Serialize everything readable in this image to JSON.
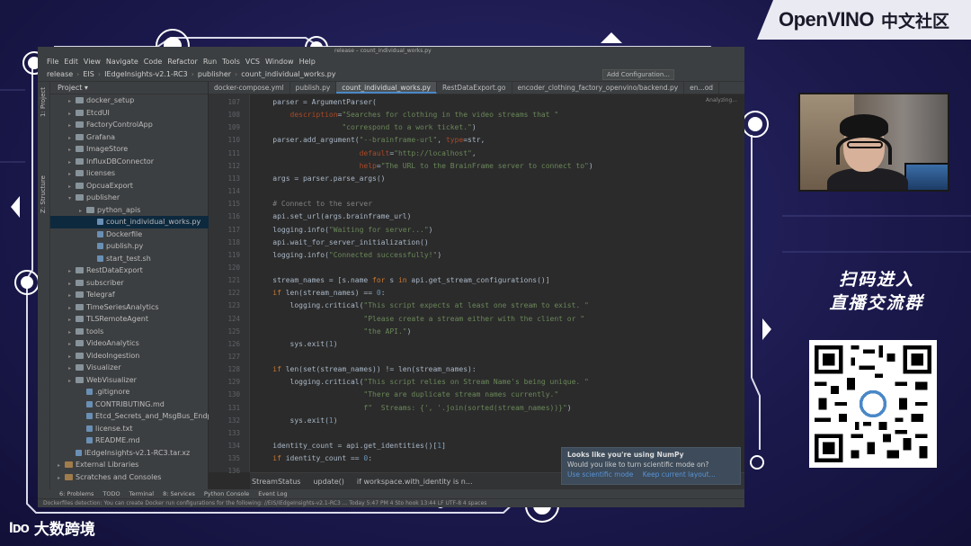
{
  "brand": {
    "name": "OpenVINO",
    "sub": "中文社区"
  },
  "qr": {
    "title_line1": "扫码进入",
    "title_line2": "直播交流群"
  },
  "logo": {
    "mark": "Iᴅᴏ",
    "text": "大数跨境"
  },
  "window": {
    "title": "release – count_individual_works.py"
  },
  "menu": [
    "File",
    "Edit",
    "View",
    "Navigate",
    "Code",
    "Refactor",
    "Run",
    "Tools",
    "VCS",
    "Window",
    "Help"
  ],
  "nav": {
    "crumbs": [
      "release",
      "EIS",
      "IEdgeInsights-v2.1-RC3",
      "publisher",
      "count_individual_works.py"
    ],
    "add_config": "Add Configuration..."
  },
  "toolstrip": {
    "project": "1: Project",
    "structure": "Z: Structure"
  },
  "project": {
    "header": "Project",
    "items": [
      {
        "label": "docker_setup",
        "type": "folder",
        "indent": 1
      },
      {
        "label": "EtcdUI",
        "type": "folder",
        "indent": 1
      },
      {
        "label": "FactoryControlApp",
        "type": "folder",
        "indent": 1
      },
      {
        "label": "Grafana",
        "type": "folder",
        "indent": 1
      },
      {
        "label": "ImageStore",
        "type": "folder",
        "indent": 1
      },
      {
        "label": "InfluxDBConnector",
        "type": "folder",
        "indent": 1
      },
      {
        "label": "licenses",
        "type": "folder",
        "indent": 1
      },
      {
        "label": "OpcuaExport",
        "type": "folder",
        "indent": 1
      },
      {
        "label": "publisher",
        "type": "folder",
        "indent": 1,
        "open": true
      },
      {
        "label": "python_apis",
        "type": "folder",
        "indent": 2
      },
      {
        "label": "count_individual_works.py",
        "type": "file",
        "indent": 3,
        "selected": true
      },
      {
        "label": "Dockerfile",
        "type": "file",
        "indent": 3
      },
      {
        "label": "publish.py",
        "type": "file",
        "indent": 3
      },
      {
        "label": "start_test.sh",
        "type": "file",
        "indent": 3
      },
      {
        "label": "RestDataExport",
        "type": "folder",
        "indent": 1
      },
      {
        "label": "subscriber",
        "type": "folder",
        "indent": 1
      },
      {
        "label": "Telegraf",
        "type": "folder",
        "indent": 1
      },
      {
        "label": "TimeSeriesAnalytics",
        "type": "folder",
        "indent": 1
      },
      {
        "label": "TLSRemoteAgent",
        "type": "folder",
        "indent": 1
      },
      {
        "label": "tools",
        "type": "folder",
        "indent": 1
      },
      {
        "label": "VideoAnalytics",
        "type": "folder",
        "indent": 1
      },
      {
        "label": "VideoIngestion",
        "type": "folder",
        "indent": 1
      },
      {
        "label": "Visualizer",
        "type": "folder",
        "indent": 1
      },
      {
        "label": "WebVisualizer",
        "type": "folder",
        "indent": 1
      },
      {
        "label": ".gitignore",
        "type": "file",
        "indent": 2
      },
      {
        "label": "CONTRIBUTING.md",
        "type": "file",
        "indent": 2
      },
      {
        "label": "Etcd_Secrets_and_MsgBus_Endpoin",
        "type": "file",
        "indent": 2
      },
      {
        "label": "license.txt",
        "type": "file",
        "indent": 2
      },
      {
        "label": "README.md",
        "type": "file",
        "indent": 2
      },
      {
        "label": "IEdgeInsights-v2.1-RC3.tar.xz",
        "type": "file",
        "indent": 1
      },
      {
        "label": "External Libraries",
        "type": "lib",
        "indent": 0
      },
      {
        "label": "Scratches and Consoles",
        "type": "lib",
        "indent": 0
      }
    ]
  },
  "tabs": [
    {
      "label": "docker-compose.yml"
    },
    {
      "label": "publish.py"
    },
    {
      "label": "count_individual_works.py",
      "active": true
    },
    {
      "label": "RestDataExport.go"
    },
    {
      "label": "encoder_clothing_factory_openvino/backend.py"
    },
    {
      "label": "en...od"
    }
  ],
  "editor": {
    "analyzing": "Analyzing...",
    "line_numbers": [
      "107",
      "108",
      "109",
      "110",
      "111",
      "112",
      "113",
      "114",
      "115",
      "116",
      "117",
      "118",
      "119",
      "120",
      "121",
      "122",
      "123",
      "124",
      "125",
      "126",
      "127",
      "128",
      "129",
      "130",
      "131",
      "132",
      "133",
      "134",
      "135",
      "136"
    ],
    "lines": [
      {
        "parts": [
          {
            "t": "    parser = ArgumentParser("
          }
        ]
      },
      {
        "parts": [
          {
            "t": "        "
          },
          {
            "t": "description",
            "c": "kw"
          },
          {
            "t": "="
          },
          {
            "t": "\"Searches for clothing in the video streams that \"",
            "c": "s"
          }
        ]
      },
      {
        "parts": [
          {
            "t": "                    "
          },
          {
            "t": "\"correspond to a work ticket.\"",
            "c": "s"
          },
          {
            "t": ")"
          }
        ]
      },
      {
        "parts": [
          {
            "t": "    parser.add_argument("
          },
          {
            "t": "\"--brainframe-url\"",
            "c": "s"
          },
          {
            "t": ", "
          },
          {
            "t": "type",
            "c": "kw"
          },
          {
            "t": "=str,"
          }
        ]
      },
      {
        "parts": [
          {
            "t": "                        "
          },
          {
            "t": "default",
            "c": "kw"
          },
          {
            "t": "="
          },
          {
            "t": "\"http://localhost\"",
            "c": "s"
          },
          {
            "t": ","
          }
        ]
      },
      {
        "parts": [
          {
            "t": "                        "
          },
          {
            "t": "help",
            "c": "kw"
          },
          {
            "t": "="
          },
          {
            "t": "\"The URL to the BrainFrame server to connect to\"",
            "c": "s"
          },
          {
            "t": ")"
          }
        ]
      },
      {
        "parts": [
          {
            "t": "    args = parser.parse_args()"
          }
        ]
      },
      {
        "parts": [
          {
            "t": ""
          }
        ]
      },
      {
        "parts": [
          {
            "t": "    "
          },
          {
            "t": "# Connect to the server",
            "c": "c"
          }
        ]
      },
      {
        "parts": [
          {
            "t": "    api.set_url(args.brainframe_url)"
          }
        ]
      },
      {
        "parts": [
          {
            "t": "    logging.info("
          },
          {
            "t": "\"Waiting for server...\"",
            "c": "s"
          },
          {
            "t": ")"
          }
        ]
      },
      {
        "parts": [
          {
            "t": "    api.wait_for_server_initialization()"
          }
        ]
      },
      {
        "parts": [
          {
            "t": "    logging.info("
          },
          {
            "t": "\"Connected successfully!\"",
            "c": "s"
          },
          {
            "t": ")"
          }
        ]
      },
      {
        "parts": [
          {
            "t": ""
          }
        ]
      },
      {
        "parts": [
          {
            "t": "    stream_names = [s.name "
          },
          {
            "t": "for",
            "c": "k"
          },
          {
            "t": " s "
          },
          {
            "t": "in",
            "c": "k"
          },
          {
            "t": " api.get_stream_configurations()]"
          }
        ]
      },
      {
        "parts": [
          {
            "t": "    "
          },
          {
            "t": "if",
            "c": "k"
          },
          {
            "t": " len(stream_names) == "
          },
          {
            "t": "0",
            "c": "n"
          },
          {
            "t": ":"
          }
        ]
      },
      {
        "parts": [
          {
            "t": "        logging.critical("
          },
          {
            "t": "\"This script expects at least one stream to exist. \"",
            "c": "s"
          }
        ]
      },
      {
        "parts": [
          {
            "t": "                         "
          },
          {
            "t": "\"Please create a stream either with the client or \"",
            "c": "s"
          }
        ]
      },
      {
        "parts": [
          {
            "t": "                         "
          },
          {
            "t": "\"the API.\"",
            "c": "s"
          },
          {
            "t": ")"
          }
        ]
      },
      {
        "parts": [
          {
            "t": "        sys.exit("
          },
          {
            "t": "1",
            "c": "n"
          },
          {
            "t": ")"
          }
        ]
      },
      {
        "parts": [
          {
            "t": ""
          }
        ]
      },
      {
        "parts": [
          {
            "t": "    "
          },
          {
            "t": "if",
            "c": "k"
          },
          {
            "t": " len(set(stream_names)) != len(stream_names):"
          }
        ]
      },
      {
        "parts": [
          {
            "t": "        logging.critical("
          },
          {
            "t": "\"This script relies on Stream Name's being unique. \"",
            "c": "s"
          }
        ]
      },
      {
        "parts": [
          {
            "t": "                         "
          },
          {
            "t": "\"There are duplicate stream names currently.\"",
            "c": "s"
          }
        ]
      },
      {
        "parts": [
          {
            "t": "                         "
          },
          {
            "t": "f\"  Streams: {', '.join(sorted(stream_names))}\"",
            "c": "s"
          },
          {
            "t": ")"
          }
        ]
      },
      {
        "parts": [
          {
            "t": "        sys.exit("
          },
          {
            "t": "1",
            "c": "n"
          },
          {
            "t": ")"
          }
        ]
      },
      {
        "parts": [
          {
            "t": ""
          }
        ]
      },
      {
        "parts": [
          {
            "t": "    identity_count = api.get_identities()["
          },
          {
            "t": "1",
            "c": "n"
          },
          {
            "t": "]"
          }
        ]
      },
      {
        "parts": [
          {
            "t": "    "
          },
          {
            "t": "if",
            "c": "k"
          },
          {
            "t": " identity_count == "
          },
          {
            "t": "0",
            "c": "n"
          },
          {
            "t": ":"
          }
        ]
      }
    ]
  },
  "breadcrumb": [
    "StreamStatus",
    "update()",
    "if workspace.with_identity is n..."
  ],
  "bottom_tabs": [
    "6: Problems",
    "TODO",
    "Terminal",
    "8: Services",
    "Python Console",
    "Event Log"
  ],
  "status": "Dockerfiles detection: You can create Docker run configurations for the following: //EIS/IEdgeInsights-v2.1-RC3 ... Today 5:47 PM    4 Sto hook    13:44    LF    UTF-8    4 spaces",
  "notification": {
    "title": "Looks like you're using NumPy",
    "message": "Would you like to turn scientific mode on?",
    "action1": "Use scientific mode",
    "action2": "Keep current layout..."
  },
  "colors": {
    "background": "#1c1a4e",
    "frame": "#e8e8f5",
    "ide_bg": "#2b2b2b",
    "accent": "#4a88c7"
  }
}
